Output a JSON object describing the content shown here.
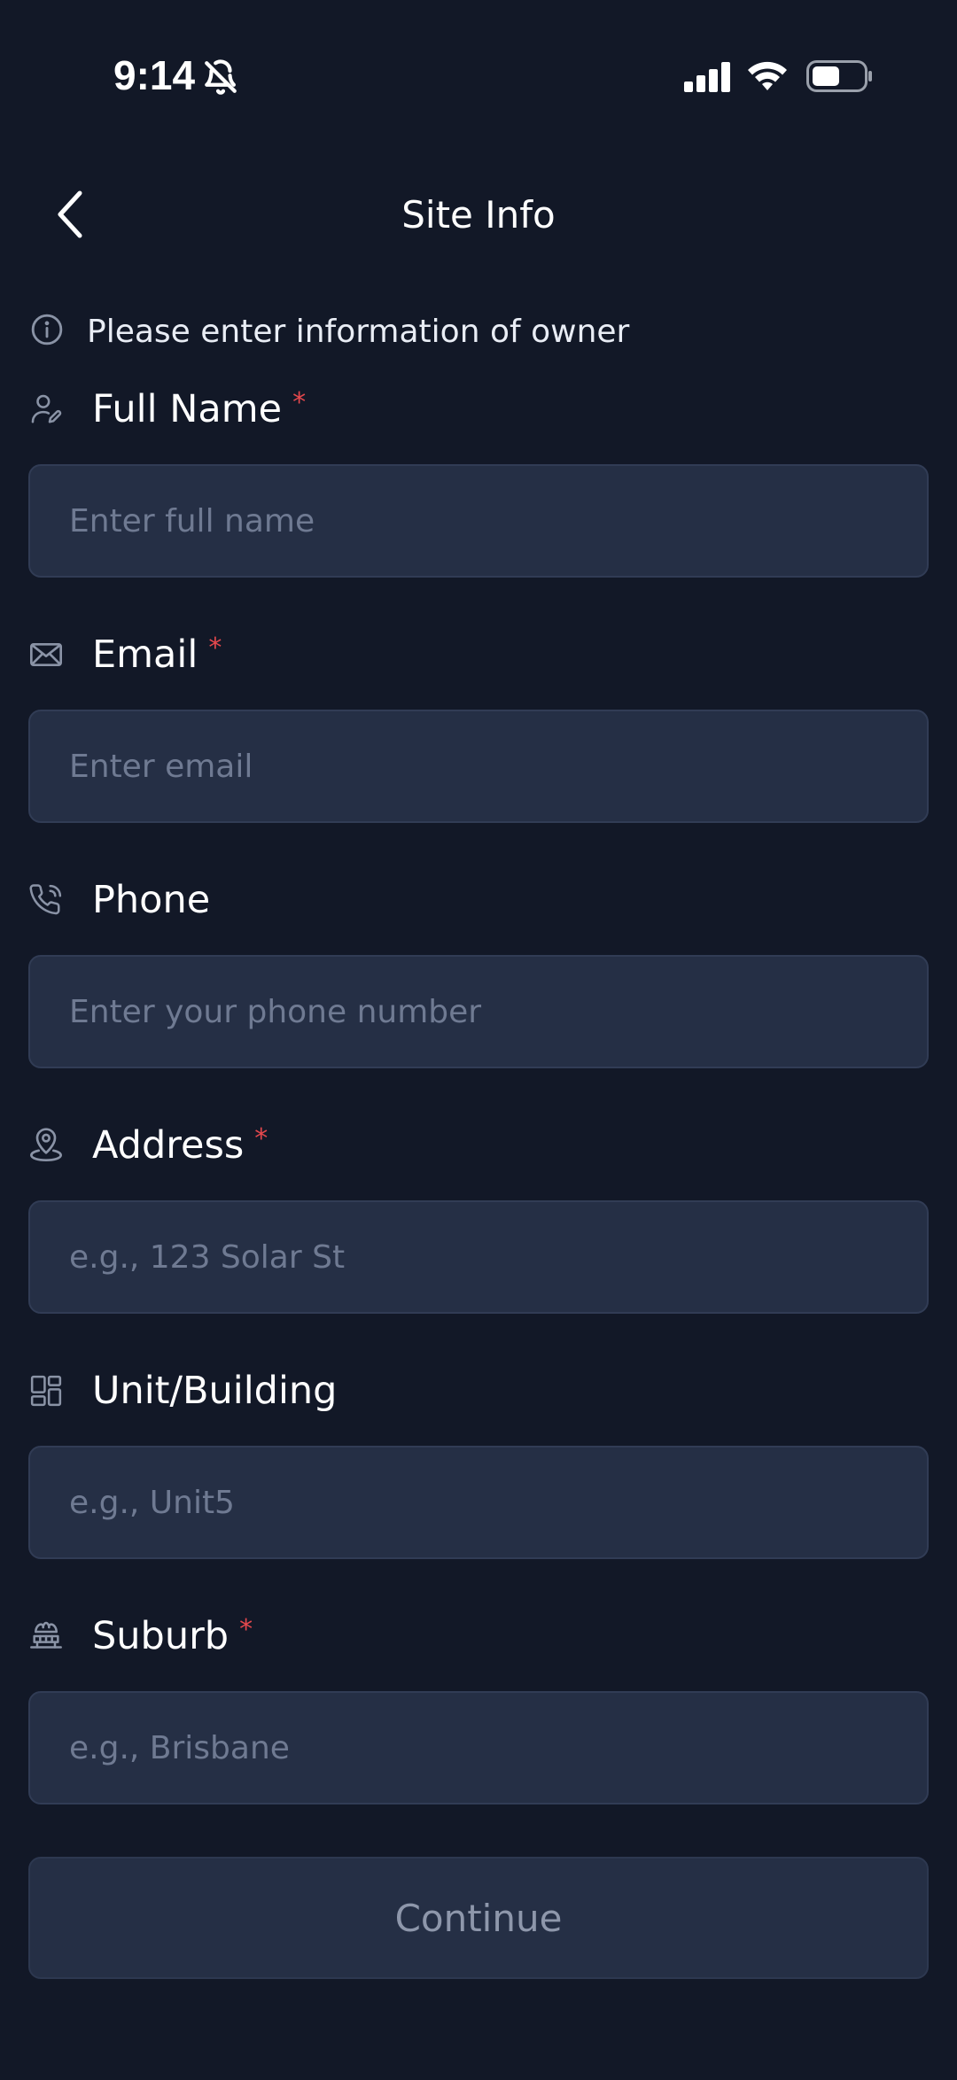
{
  "status_bar": {
    "time": "9:14"
  },
  "icons": {
    "bell": "bell-slash-icon",
    "signal": "cellular-signal-icon",
    "wifi": "wifi-icon",
    "battery": "battery-icon",
    "back": "chevron-left-icon",
    "info": "info-circle-icon",
    "person": "user-edit-icon",
    "mail": "mail-icon",
    "phone": "phone-icon",
    "location": "location-pin-icon",
    "building": "grid-building-icon",
    "suburb": "suburb-icon"
  },
  "colors": {
    "background": "#121827",
    "input_background": "#252f45",
    "required": "#e5484d",
    "placeholder": "#6f7a92",
    "button_text": "#8e97ab"
  },
  "header": {
    "title": "Site Info"
  },
  "info": {
    "text": "Please enter information of owner"
  },
  "fields": {
    "full_name": {
      "label": "Full Name",
      "required_mark": "*",
      "placeholder": "Enter full name",
      "value": ""
    },
    "email": {
      "label": "Email",
      "required_mark": "*",
      "placeholder": "Enter email",
      "value": ""
    },
    "phone": {
      "label": "Phone",
      "placeholder": "Enter your phone number",
      "value": ""
    },
    "address": {
      "label": "Address",
      "required_mark": "*",
      "placeholder": "e.g., 123 Solar St",
      "value": ""
    },
    "unit": {
      "label": "Unit/Building",
      "placeholder": "e.g., Unit5",
      "value": ""
    },
    "suburb": {
      "label": "Suburb",
      "required_mark": "*",
      "placeholder": "e.g., Brisbane",
      "value": ""
    }
  },
  "actions": {
    "continue_label": "Continue"
  }
}
